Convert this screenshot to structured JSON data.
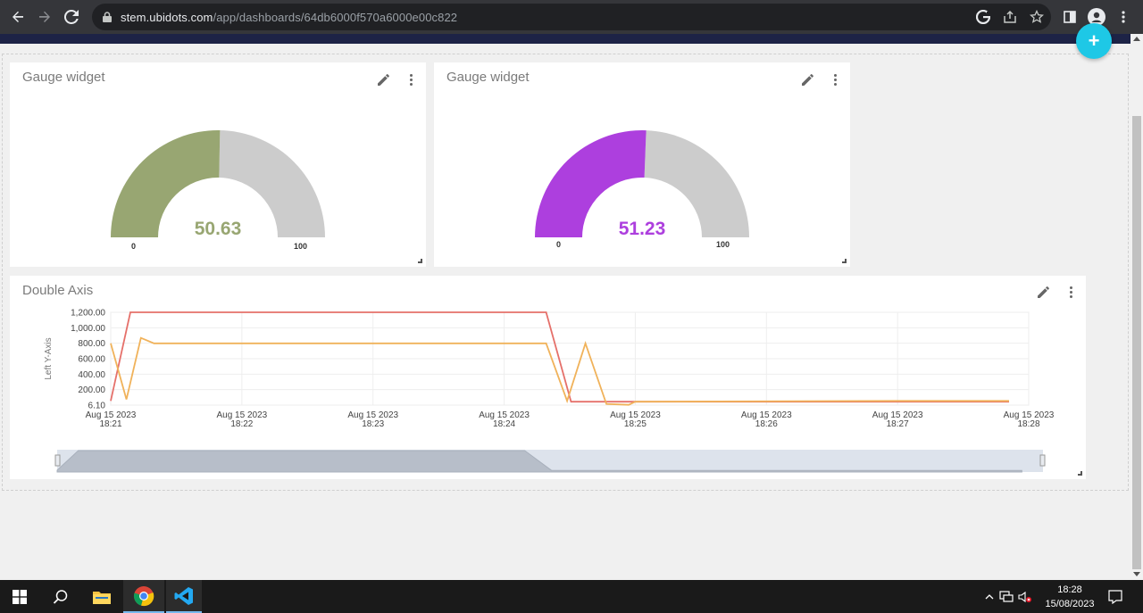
{
  "browser": {
    "url_host": "stem.ubidots.com",
    "url_path": "/app/dashboards/64db6000f570a6000e00c822"
  },
  "fab": {
    "label": "+"
  },
  "gauges": [
    {
      "title": "Gauge widget",
      "value": "50.63",
      "min": "0",
      "max": "100",
      "fill_color": "#98a672",
      "value_color": "#98a672",
      "track_color": "#cccccc"
    },
    {
      "title": "Gauge widget",
      "value": "51.23",
      "min": "0",
      "max": "100",
      "fill_color": "#ad3fde",
      "value_color": "#ad3fde",
      "track_color": "#cccccc"
    }
  ],
  "chart_widget": {
    "title": "Double Axis"
  },
  "chart_data": {
    "type": "line",
    "ylabel": "Left Y-Axis",
    "ylim": [
      6.1,
      1200
    ],
    "y_ticks": [
      "1,200.00",
      "1,000.00",
      "800.00",
      "600.00",
      "400.00",
      "200.00",
      "6.10"
    ],
    "x_ticks": [
      [
        "Aug 15 2023",
        "18:21"
      ],
      [
        "Aug 15 2023",
        "18:22"
      ],
      [
        "Aug 15 2023",
        "18:23"
      ],
      [
        "Aug 15 2023",
        "18:24"
      ],
      [
        "Aug 15 2023",
        "18:25"
      ],
      [
        "Aug 15 2023",
        "18:26"
      ],
      [
        "Aug 15 2023",
        "18:27"
      ],
      [
        "Aug 15 2023",
        "18:28"
      ]
    ],
    "series": [
      {
        "color": "#e5706a",
        "points": [
          [
            18.21,
            60
          ],
          [
            18.2115,
            1200
          ],
          [
            18.2432,
            1200
          ],
          [
            18.2451,
            50
          ],
          [
            18.2475,
            50
          ],
          [
            18.26,
            50
          ],
          [
            18.2785,
            50
          ]
        ]
      },
      {
        "color": "#f0b25a",
        "points": [
          [
            18.21,
            800
          ],
          [
            18.2112,
            80
          ],
          [
            18.2123,
            870
          ],
          [
            18.2133,
            800
          ],
          [
            18.2352,
            800
          ],
          [
            18.2432,
            800
          ],
          [
            18.2448,
            60
          ],
          [
            18.2462,
            800
          ],
          [
            18.2478,
            20
          ],
          [
            18.2495,
            10
          ],
          [
            18.25,
            50
          ],
          [
            18.27,
            60
          ],
          [
            18.2785,
            60
          ]
        ]
      }
    ]
  },
  "taskbar": {
    "time": "18:28",
    "date": "15/08/2023"
  }
}
